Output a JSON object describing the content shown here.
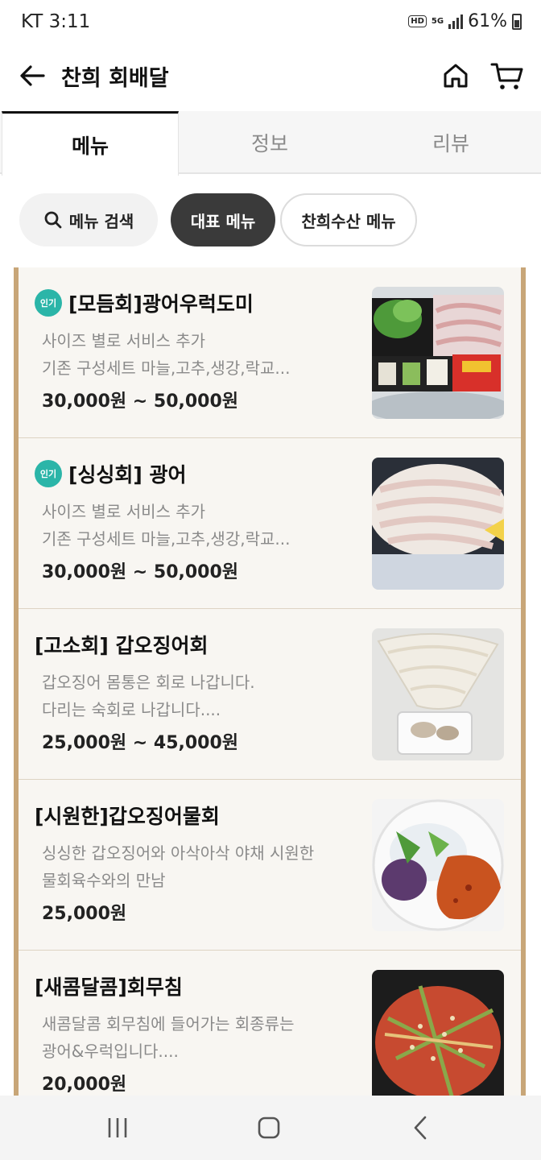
{
  "status_bar": {
    "carrier_time": "KT 3:11",
    "hd": "HD",
    "network": "5G",
    "battery": "61%"
  },
  "header": {
    "title": "찬희 회배달",
    "icons": [
      "back-arrow-icon",
      "home-icon",
      "cart-icon"
    ]
  },
  "tabs": [
    {
      "label": "메뉴",
      "active": true
    },
    {
      "label": "정보",
      "active": false
    },
    {
      "label": "리뷰",
      "active": false
    }
  ],
  "filters": {
    "search_label": "메뉴 검색",
    "chips": [
      {
        "label": "대표 메뉴",
        "selected": true
      },
      {
        "label": "찬희수산 메뉴",
        "selected": false
      }
    ]
  },
  "menu_items": [
    {
      "badge": "인기",
      "name": "[모듬회]광어우럭도미",
      "desc_line1": "사이즈 별로 서비스 추가",
      "desc_line2": "기존 구성세트 마늘,고추,생강,락교...",
      "price": "30,000원 ~ 50,000원"
    },
    {
      "badge": "인기",
      "name": "[싱싱회] 광어",
      "desc_line1": "사이즈 별로 서비스 추가",
      "desc_line2": "기존 구성세트 마늘,고추,생강,락교...",
      "price": "30,000원 ~ 50,000원"
    },
    {
      "name": "[고소회] 갑오징어회",
      "desc_line1": "갑오징어 몸통은 회로 나갑니다.",
      "desc_line2": "다리는 숙회로 나갑니다....",
      "price": "25,000원 ~ 45,000원"
    },
    {
      "name": "[시원한]갑오징어물회",
      "desc_line1": "싱싱한 갑오징어와 아삭아삭 야채 시원한",
      "desc_line2": "물회육수와의 만남",
      "price": "25,000원"
    },
    {
      "name": "[새콤달콤]회무침",
      "desc_line1": "새콤달콤 회무침에 들어가는 회종류는",
      "desc_line2": "광어&우럭입니다....",
      "price": "20,000원"
    }
  ],
  "colors": {
    "badge": "#2bb5a8",
    "list_border": "#c8a678",
    "chip_selected": "#3a3a3a"
  }
}
